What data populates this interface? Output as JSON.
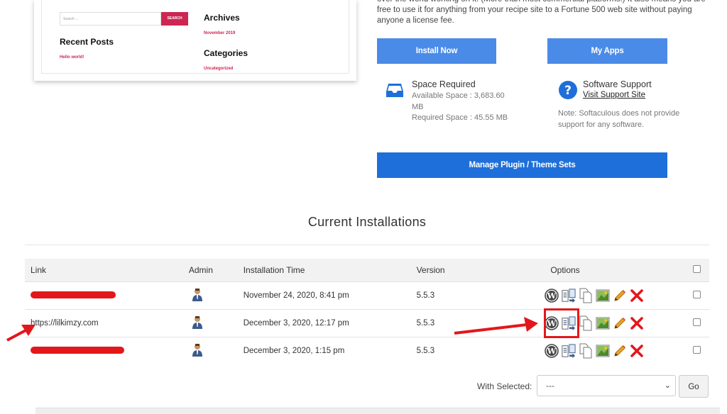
{
  "preview": {
    "search_placeholder": "Search ...",
    "search_button": "SEARCH",
    "recent_posts_heading": "Recent Posts",
    "recent_post": "Hello world!",
    "archives_heading": "Archives",
    "archive_item": "November 2019",
    "categories_heading": "Categories",
    "category_item": "Uncategorized"
  },
  "description": "over the world working on it. (More than most commercial platforms.) It also means you are free to use it for anything from your recipe site to a Fortune 500 web site without paying anyone a license fee.",
  "buttons": {
    "install_now": "Install Now",
    "my_apps": "My Apps",
    "manage_sets": "Manage Plugin / Theme Sets"
  },
  "space": {
    "title": "Space Required",
    "available": "Available Space : 3,683.60 MB",
    "required": "Required Space : 45.55 MB"
  },
  "support": {
    "title": "Software Support",
    "link": "Visit Support Site",
    "note": "Note: Softaculous does not provide support for any software."
  },
  "installations": {
    "title": "Current Installations",
    "headers": {
      "link": "Link",
      "admin": "Admin",
      "time": "Installation Time",
      "version": "Version",
      "options": "Options"
    },
    "rows": [
      {
        "link": "",
        "time": "November 24, 2020, 8:41 pm",
        "version": "5.5.3"
      },
      {
        "link": "https://lilkimzy.com",
        "time": "December 3, 2020, 12:17 pm",
        "version": "5.5.3"
      },
      {
        "link": "",
        "time": "December 3, 2020, 1:15 pm",
        "version": "5.5.3"
      }
    ]
  },
  "bulk": {
    "label": "With Selected:",
    "selected": "---",
    "go": "Go"
  },
  "colors": {
    "button_light": "#4a8be8",
    "button_dark": "#1e6fd9",
    "annotation_red": "#e3171b",
    "preview_accent": "#cd2653"
  }
}
